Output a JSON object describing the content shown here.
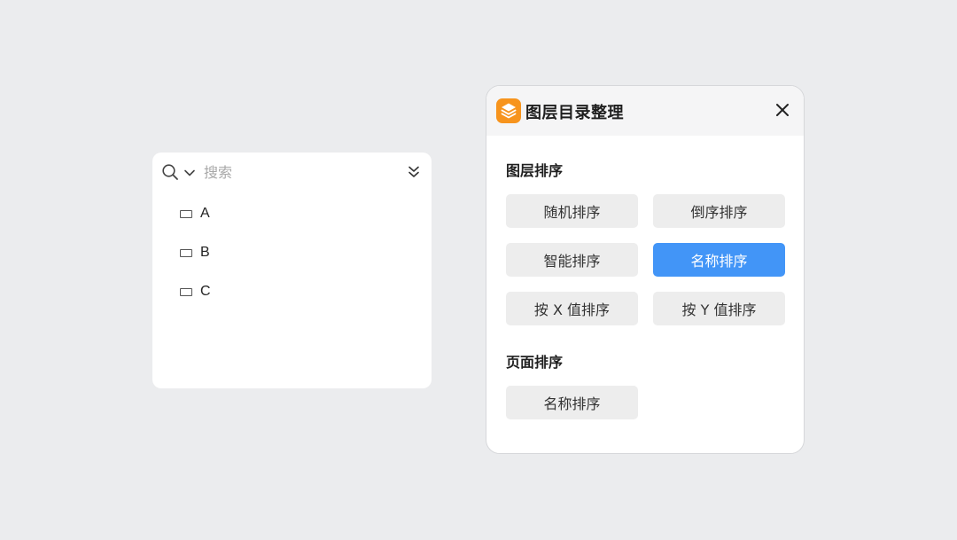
{
  "layers_panel": {
    "search": {
      "placeholder": "搜索",
      "value": ""
    },
    "items": [
      {
        "label": "A"
      },
      {
        "label": "B"
      },
      {
        "label": "C"
      }
    ]
  },
  "dialog": {
    "title": "图层目录整理",
    "layer_sort": {
      "title": "图层排序",
      "buttons": [
        {
          "label": "随机排序",
          "active": false
        },
        {
          "label": "倒序排序",
          "active": false
        },
        {
          "label": "智能排序",
          "active": false
        },
        {
          "label": "名称排序",
          "active": true
        },
        {
          "label": "按 X 值排序",
          "active": false
        },
        {
          "label": "按 Y 值排序",
          "active": false
        }
      ]
    },
    "page_sort": {
      "title": "页面排序",
      "buttons": [
        {
          "label": "名称排序",
          "active": false
        }
      ]
    }
  },
  "colors": {
    "background": "#ebecee",
    "accent": "#4295f7",
    "logo": "#f7941d",
    "button": "#ededed"
  }
}
